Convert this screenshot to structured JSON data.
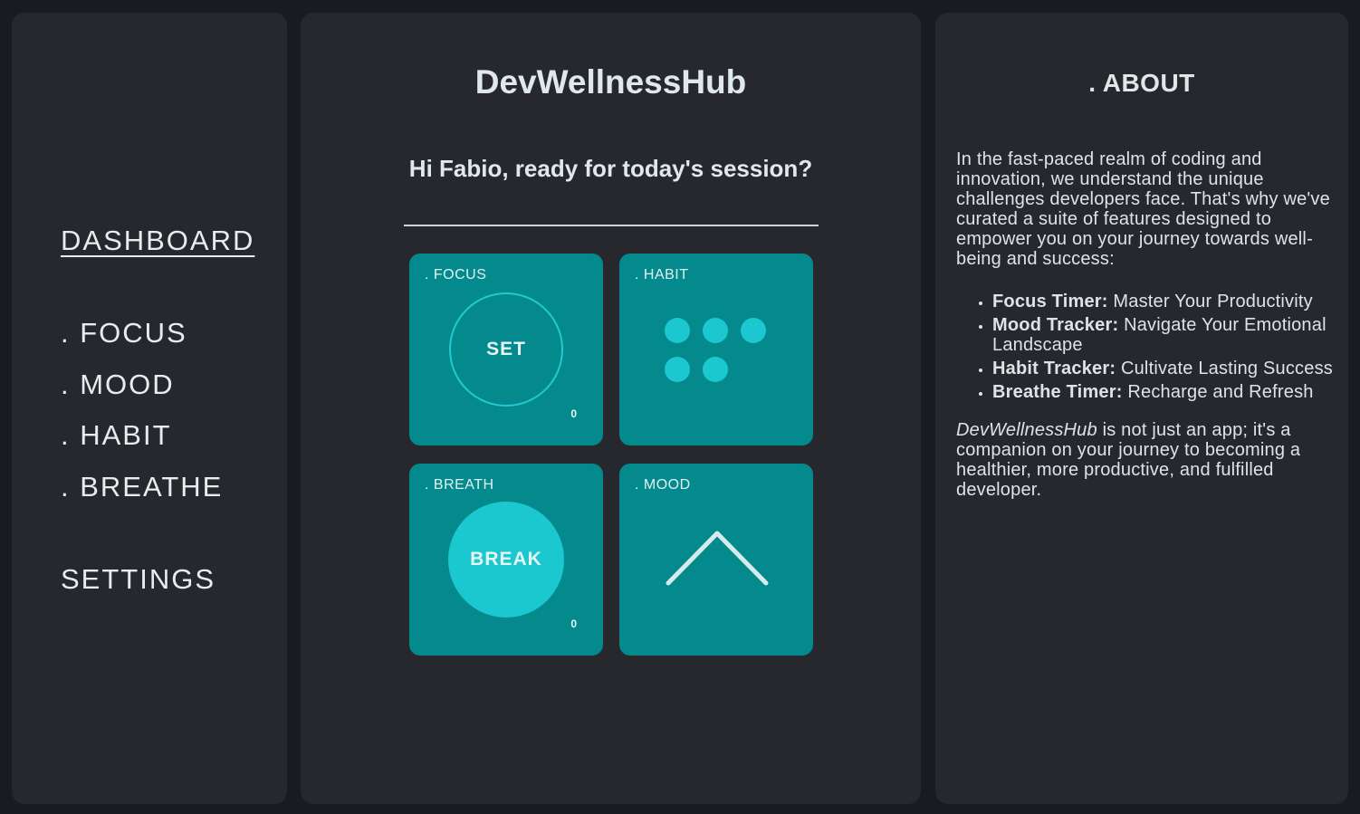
{
  "sidebar": {
    "dashboard": "DASHBOARD",
    "items": [
      ". FOCUS",
      ". MOOD",
      ". HABIT",
      ". BREATHE"
    ],
    "settings": "SETTINGS"
  },
  "main": {
    "title": "DevWellnessHub",
    "greeting": "Hi Fabio, ready for today's session?",
    "tiles": {
      "focus": {
        "label": ". FOCUS",
        "button": "SET",
        "count": "0"
      },
      "habit": {
        "label": ". HABIT",
        "dot_count": 5
      },
      "breath": {
        "label": ". BREATH",
        "button": "BREAK",
        "count": "0"
      },
      "mood": {
        "label": ". MOOD",
        "icon": "chevron-up-icon"
      }
    }
  },
  "about": {
    "title": ". ABOUT",
    "intro": "In the fast-paced realm of coding and innovation, we understand the unique challenges developers face. That's why we've curated a suite of features designed to empower you on your journey towards well-being and success:",
    "features": [
      {
        "name": "Focus Timer:",
        "desc": "Master Your Productivity"
      },
      {
        "name": "Mood Tracker:",
        "desc": "Navigate Your Emotional Landscape"
      },
      {
        "name": "Habit Tracker:",
        "desc": "Cultivate Lasting Success"
      },
      {
        "name": "Breathe Timer:",
        "desc": "Recharge and Refresh"
      }
    ],
    "outro_brand": "DevWellnessHub",
    "outro_text": " is not just an app; it's a companion on your journey to becoming a healthier, more productive, and fulfilled developer."
  },
  "colors": {
    "background": "#181b20",
    "panel": "#26282d",
    "tile": "#04898d",
    "accent": "#1bc8d0"
  }
}
